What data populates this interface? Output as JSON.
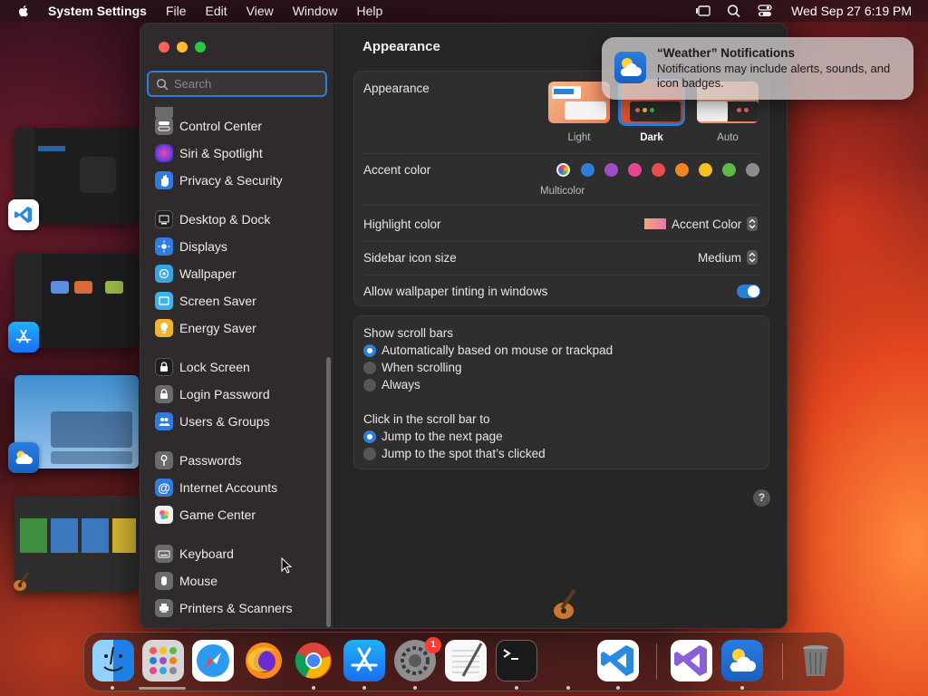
{
  "menubar": {
    "app_name": "System Settings",
    "menus": [
      "File",
      "Edit",
      "View",
      "Window",
      "Help"
    ],
    "clock": "Wed Sep 27  6:19 PM"
  },
  "window": {
    "search_placeholder": "Search",
    "sidebar": {
      "items": [
        {
          "label": "Control Center",
          "icon": "control-center-icon",
          "color": "#6b6b6b"
        },
        {
          "label": "Siri & Spotlight",
          "icon": "siri-icon",
          "color": "#8e3fd6"
        },
        {
          "label": "Privacy & Security",
          "icon": "hand-icon",
          "color": "#2f7be0"
        },
        {
          "label": "Desktop & Dock",
          "icon": "desktop-dock-icon",
          "color": "#3a3a3a"
        },
        {
          "label": "Displays",
          "icon": "displays-icon",
          "color": "#2f7be0"
        },
        {
          "label": "Wallpaper",
          "icon": "wallpaper-icon",
          "color": "#38a4e0"
        },
        {
          "label": "Screen Saver",
          "icon": "screen-saver-icon",
          "color": "#3fb2e6"
        },
        {
          "label": "Energy Saver",
          "icon": "energy-saver-icon",
          "color": "#f3b428"
        },
        {
          "label": "Lock Screen",
          "icon": "lock-screen-icon",
          "color": "#3a3a3a"
        },
        {
          "label": "Login Password",
          "icon": "lock-icon",
          "color": "#6b6b6b"
        },
        {
          "label": "Users & Groups",
          "icon": "users-icon",
          "color": "#2f7be0"
        },
        {
          "label": "Passwords",
          "icon": "key-icon",
          "color": "#6b6b6b"
        },
        {
          "label": "Internet Accounts",
          "icon": "at-icon",
          "color": "#2f7be0"
        },
        {
          "label": "Game Center",
          "icon": "game-center-icon",
          "color": "#e9e9e9"
        },
        {
          "label": "Keyboard",
          "icon": "keyboard-icon",
          "color": "#6b6b6b"
        },
        {
          "label": "Mouse",
          "icon": "mouse-icon",
          "color": "#6b6b6b"
        },
        {
          "label": "Printers & Scanners",
          "icon": "printer-icon",
          "color": "#6b6b6b"
        }
      ]
    },
    "main": {
      "title": "Appearance",
      "appearance": {
        "label": "Appearance",
        "options": [
          {
            "label": "Light",
            "selected": false
          },
          {
            "label": "Dark",
            "selected": true
          },
          {
            "label": "Auto",
            "selected": false
          }
        ]
      },
      "accent": {
        "label": "Accent color",
        "selected_label": "Multicolor",
        "colors": [
          "multicolor",
          "#2c7ed6",
          "#9c4ec7",
          "#e5468f",
          "#ea4b4b",
          "#f08423",
          "#f6c21a",
          "#5fb944",
          "#8c8c8c"
        ]
      },
      "highlight": {
        "label": "Highlight color",
        "value": "Accent Color"
      },
      "sidebar_icon_size": {
        "label": "Sidebar icon size",
        "value": "Medium"
      },
      "tinting": {
        "label": "Allow wallpaper tinting in windows",
        "on": true
      },
      "scroll_bars": {
        "label": "Show scroll bars",
        "options": [
          {
            "label": "Automatically based on mouse or trackpad",
            "selected": true
          },
          {
            "label": "When scrolling",
            "selected": false
          },
          {
            "label": "Always",
            "selected": false
          }
        ]
      },
      "click_scroll": {
        "label": "Click in the scroll bar to",
        "options": [
          {
            "label": "Jump to the next page",
            "selected": true
          },
          {
            "label": "Jump to the spot that’s clicked",
            "selected": false
          }
        ]
      },
      "help": "?"
    }
  },
  "notification": {
    "title": "“Weather” Notifications",
    "body": "Notifications may include alerts, sounds, and icon badges."
  },
  "dock": {
    "apps": [
      "Finder",
      "Launchpad",
      "Safari",
      "Firefox",
      "Chrome",
      "App Store",
      "System Settings",
      "TextEdit",
      "Terminal",
      "VS Code",
      "Visual Studio",
      "Weather",
      "Trash"
    ],
    "settings_badge": "1"
  }
}
